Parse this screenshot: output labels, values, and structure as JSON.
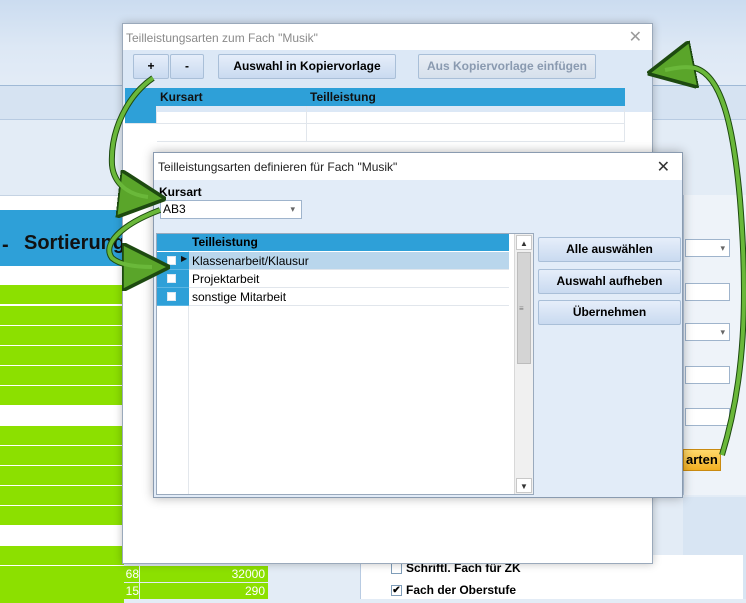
{
  "background": {
    "column_header": "Sortierung",
    "bottom_values": [
      {
        "a": "68",
        "b": "32000"
      },
      {
        "a": "15",
        "b": "290"
      }
    ],
    "right_button_label": "arten",
    "checkbox_items": [
      {
        "label": "Schriftl. Fach für ZK",
        "checked": false
      },
      {
        "label": "Fach der Oberstufe",
        "checked": true
      }
    ]
  },
  "dialog_outer": {
    "title": "Teilleistungsarten zum Fach \"Musik\"",
    "toolbar": {
      "add_label": "+",
      "remove_label": "-",
      "copy_template_label": "Auswahl in Kopiervorlage",
      "paste_template_label": "Aus Kopiervorlage einfügen"
    },
    "grid": {
      "columns": [
        "Kursart",
        "Teilleistung"
      ]
    }
  },
  "dialog_inner": {
    "title": "Teilleistungsarten definieren für Fach \"Musik\"",
    "kursart_label": "Kursart",
    "kursart_value": "AB3",
    "grid": {
      "column": "Teilleistung",
      "rows": [
        "Klassenarbeit/Klausur",
        "Projektarbeit",
        "sonstige Mitarbeit"
      ],
      "selected_index": 0
    },
    "buttons": {
      "select_all": "Alle auswählen",
      "clear_selection": "Auswahl aufheben",
      "apply": "Übernehmen"
    }
  },
  "colors": {
    "header_blue": "#2ea0d8",
    "row_green": "#8ce000",
    "arrow_green": "#5aa52a",
    "dialog_bg": "#e2ecf8"
  }
}
